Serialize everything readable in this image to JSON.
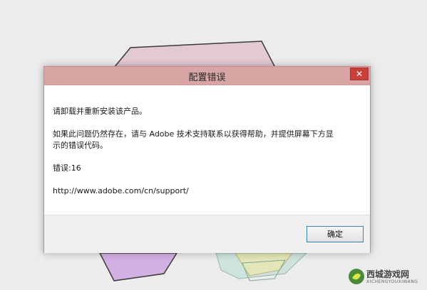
{
  "dialog": {
    "title": "配置错误",
    "close_label": "✕",
    "messages": [
      "请卸载并重新安装该产品。",
      "如果此问题仍然存在，请与 Adobe 技术支持联系以获得帮助，并提供屏幕下方显",
      "示的错误代码。",
      "错误:16",
      "http://www.adobe.com/cn/support/"
    ],
    "ok_label": "确定"
  },
  "watermark": {
    "text": "西城游戏网",
    "sub": "XICHENGYOUXIWANG"
  },
  "colors": {
    "titlebar": "#d8a4a4",
    "close_button": "#c9403b",
    "ok_border": "#3c7fb1"
  }
}
